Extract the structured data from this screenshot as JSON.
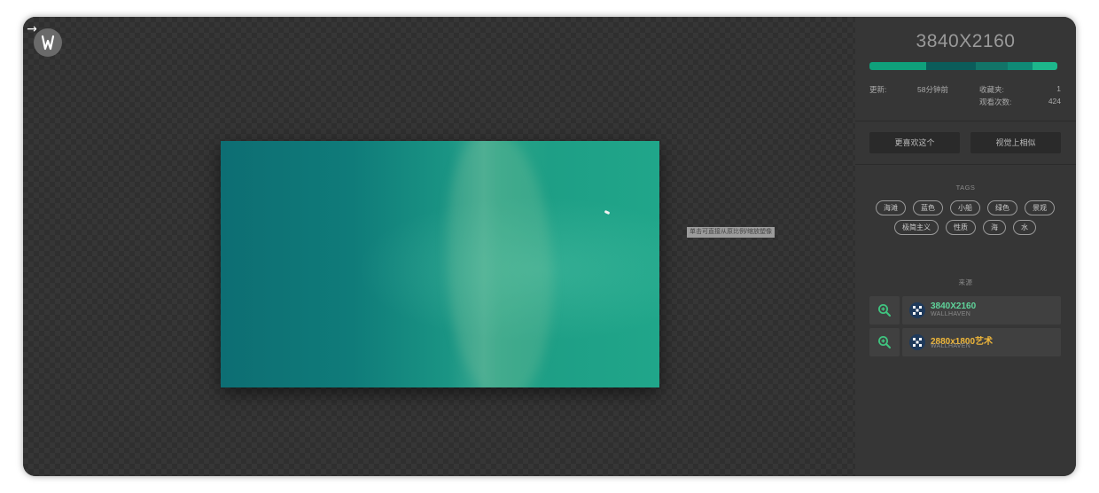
{
  "viewer": {
    "back_icon": "arrow-right-icon",
    "logo_icon": "wallhaven-w-logo",
    "hint": "单击可直接从原比例/缩放塑像"
  },
  "panel": {
    "resolution": "3840X2160",
    "palette": [
      "#0fa07b",
      "#0b5c5a",
      "#127468",
      "#0f8a76",
      "#1db68b"
    ],
    "stats": {
      "updated_label": "更新:",
      "updated_value": "58分钟前",
      "favorites_label": "收藏夹:",
      "favorites_value": "1",
      "views_label": "观看次数:",
      "views_value": "424"
    },
    "buttons": {
      "more_like": "更喜欢这个",
      "visually_similar": "视觉上相似"
    },
    "tags_title": "TAGS",
    "tags": [
      "海滩",
      "蓝色",
      "小船",
      "绿色",
      "景观",
      "极简主义",
      "性质",
      "海",
      "水"
    ],
    "source_title": "来源",
    "sources": [
      {
        "title": "3840X2160",
        "site": "WALLHAVEN",
        "color": "#5fd39a"
      },
      {
        "title": "2880x1800艺术",
        "site": "WALLHAVEN",
        "color": "#f0b73a"
      }
    ]
  }
}
